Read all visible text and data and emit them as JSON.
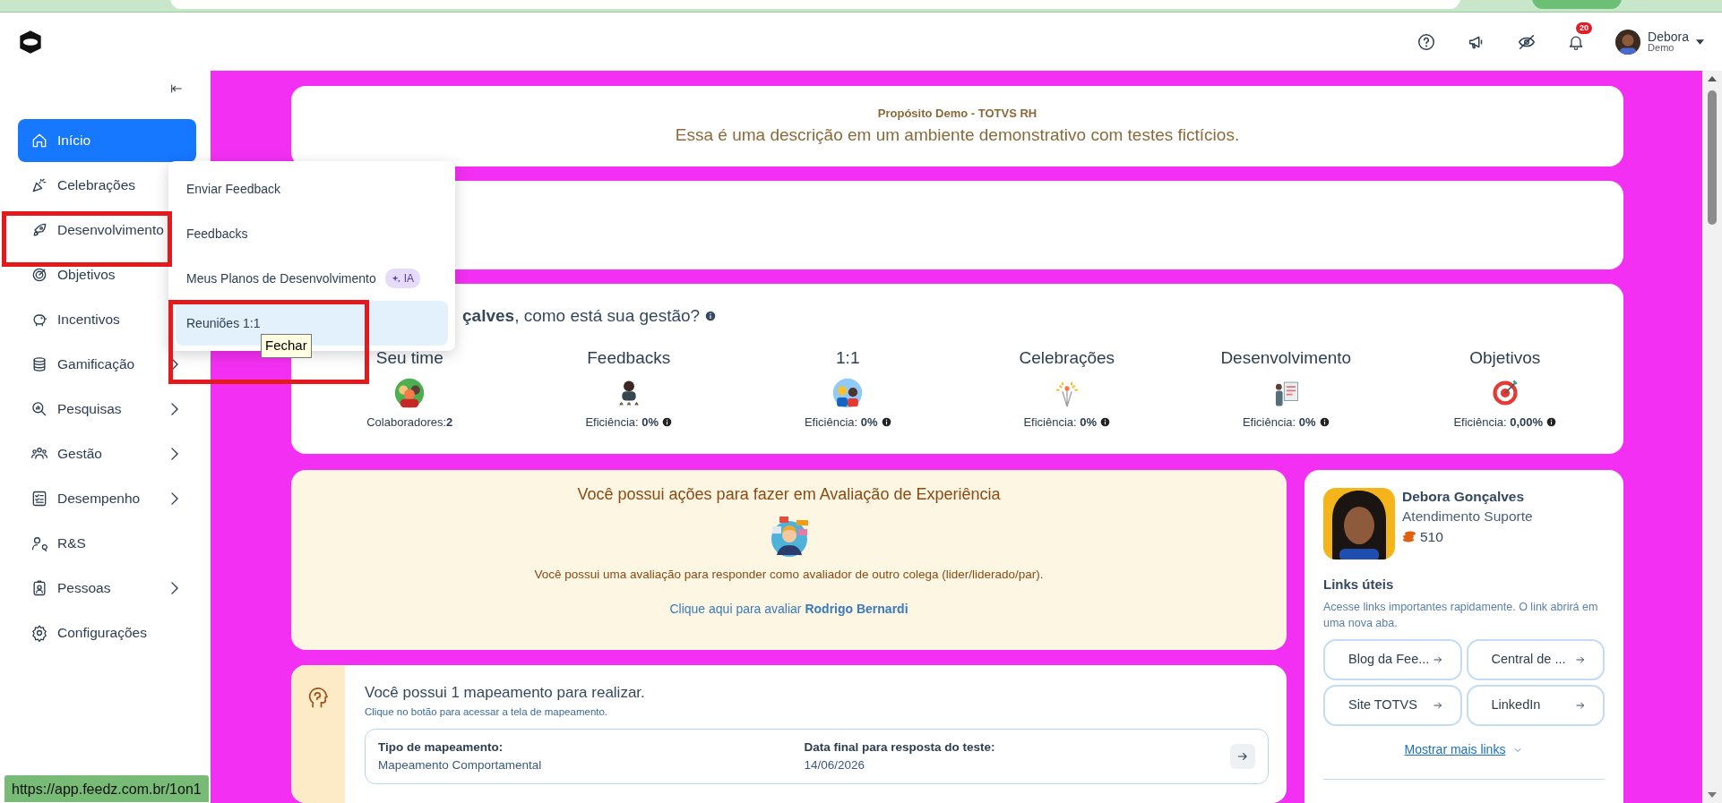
{
  "header": {
    "notification_count": "20",
    "user_name": "Debora",
    "user_role": "Demo"
  },
  "sidebar": {
    "items": [
      {
        "label": "Início",
        "selected": true,
        "has_submenu": false
      },
      {
        "label": "Celebrações",
        "selected": false,
        "has_submenu": false
      },
      {
        "label": "Desenvolvimento",
        "selected": false,
        "has_submenu": false
      },
      {
        "label": "Objetivos",
        "selected": false,
        "has_submenu": false
      },
      {
        "label": "Incentivos",
        "selected": false,
        "has_submenu": false
      },
      {
        "label": "Gamificação",
        "selected": false,
        "has_submenu": true
      },
      {
        "label": "Pesquisas",
        "selected": false,
        "has_submenu": true
      },
      {
        "label": "Gestão",
        "selected": false,
        "has_submenu": true
      },
      {
        "label": "Desempenho",
        "selected": false,
        "has_submenu": true
      },
      {
        "label": "R&S",
        "selected": false,
        "has_submenu": false
      },
      {
        "label": "Pessoas",
        "selected": false,
        "has_submenu": true
      },
      {
        "label": "Configurações",
        "selected": false,
        "has_submenu": false
      }
    ]
  },
  "submenu": {
    "items": [
      {
        "label": "Enviar Feedback",
        "selected": false
      },
      {
        "label": "Feedbacks",
        "selected": false
      },
      {
        "label": "Meus Planos de Desenvolvimento",
        "selected": false,
        "badge": "IA"
      },
      {
        "label": "Reuniões 1:1",
        "selected": true
      }
    ]
  },
  "tooltip": "Fechar",
  "purpose_card": {
    "title": "Propósito Demo - TOTVS RH",
    "description": "Essa é uma descrição em um ambiente demonstrativo com testes fictícios."
  },
  "management_card": {
    "greeting": "**çalves**, como está sua gestão?",
    "stats": [
      {
        "title": "Seu time",
        "kind": "team",
        "value": "Colaboradores:**2**",
        "info": false
      },
      {
        "title": "Feedbacks",
        "kind": "feedback",
        "value": "Eficiência: **0%**",
        "info": true
      },
      {
        "title": "1:1",
        "kind": "meeting",
        "value": "Eficiência: **0%**",
        "info": true
      },
      {
        "title": "Celebrações",
        "kind": "celebration",
        "value": "Eficiência: **0%**",
        "info": true
      },
      {
        "title": "Desenvolvimento",
        "kind": "development",
        "value": "Eficiência: **0%**",
        "info": true
      },
      {
        "title": "Objetivos",
        "kind": "goal",
        "value": "Eficiência: **0,00%**",
        "info": true
      }
    ]
  },
  "experience_card": {
    "title": "Você possui ações para fazer em Avaliação de Experiência",
    "text": "Você possui uma avaliação para responder como avaliador de outro colega (lider/liderado/par).",
    "link": "Clique aqui para avaliar **Rodrigo Bernardi**"
  },
  "mapping_card": {
    "title": "Você possui 1 mapeamento para realizar.",
    "subtitle": "Clique no botão para acessar a tela de mapeamento.",
    "fields": [
      {
        "label": "Tipo de mapeamento:",
        "value": "Mapeamento Comportamental"
      },
      {
        "label": "Data final para resposta do teste:",
        "value": "14/06/2026"
      }
    ]
  },
  "profile_card": {
    "name": "Debora Gonçalves",
    "role": "Atendimento Suporte",
    "coins": "510",
    "links_title": "Links úteis",
    "links_description": "Acesse links importantes rapidamente. O link abrirá em uma nova aba.",
    "links": [
      "Blog da Fee...",
      "Central de ...",
      "Site TOTVS",
      "LinkedIn"
    ],
    "show_more": "Mostrar mais links"
  },
  "status_bar": "https://app.feedz.com.br/1on1"
}
